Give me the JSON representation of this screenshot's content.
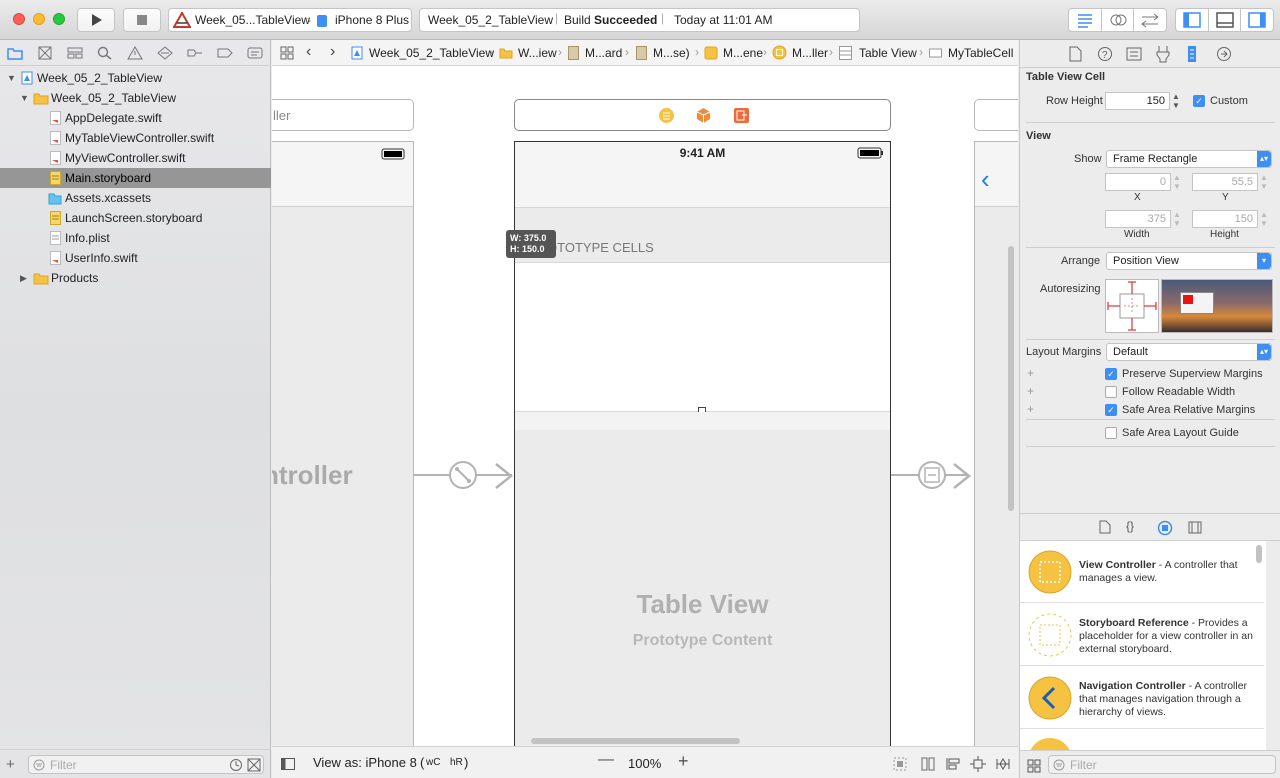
{
  "titlebar": {
    "scheme_target": "Week_05...TableView",
    "scheme_device": "iPhone 8 Plus",
    "activity_project": "Week_05_2_TableView",
    "activity_status_prefix": "Build",
    "activity_status": "Succeeded",
    "activity_time": "Today at 11:01 AM"
  },
  "navigator": {
    "items": [
      {
        "label": "Week_05_2_TableView",
        "kind": "project"
      },
      {
        "label": "Week_05_2_TableView",
        "kind": "folder"
      },
      {
        "label": "AppDelegate.swift",
        "kind": "swift"
      },
      {
        "label": "MyTableViewController.swift",
        "kind": "swift"
      },
      {
        "label": "MyViewController.swift",
        "kind": "swift"
      },
      {
        "label": "Main.storyboard",
        "kind": "storyboard"
      },
      {
        "label": "Assets.xcassets",
        "kind": "assets"
      },
      {
        "label": "LaunchScreen.storyboard",
        "kind": "storyboard"
      },
      {
        "label": "Info.plist",
        "kind": "plist"
      },
      {
        "label": "UserInfo.swift",
        "kind": "swift"
      },
      {
        "label": "Products",
        "kind": "folder"
      }
    ],
    "filter_placeholder": "Filter"
  },
  "jumpbar": {
    "crumbs": [
      "Week_05_2_TableView",
      "W...iew",
      "M...ard",
      "M...se)",
      "M...ene",
      "M...ller",
      "Table View",
      "MyTableCell"
    ]
  },
  "canvas": {
    "left_scene_title": "ller",
    "left_scene_label": "ntroller",
    "status_time": "9:41 AM",
    "prototype_header": "PROTOTYPE CELLS",
    "size_w": "W: 375.0",
    "size_h": "H: 150.0",
    "table_title": "Table View",
    "table_subtitle": "Prototype Content"
  },
  "bottombar": {
    "view_as": "View as: iPhone 8",
    "size_class_w": "wC",
    "size_class_h": "hR",
    "zoom": "100%"
  },
  "inspector": {
    "cell_section": "Table View Cell",
    "row_height_label": "Row Height",
    "row_height_value": "150",
    "custom_label": "Custom",
    "view_section": "View",
    "show_label": "Show",
    "show_value": "Frame Rectangle",
    "x_value": "0",
    "y_value": "55.5",
    "x_label": "X",
    "y_label": "Y",
    "width_value": "375",
    "height_value": "150",
    "width_label": "Width",
    "height_label": "Height",
    "arrange_label": "Arrange",
    "arrange_value": "Position View",
    "autoresizing_label": "Autoresizing",
    "layout_margins_label": "Layout Margins",
    "layout_margins_value": "Default",
    "preserve_label": "Preserve Superview Margins",
    "readable_label": "Follow Readable Width",
    "safe_margins_label": "Safe Area Relative Margins",
    "safe_guide_label": "Safe Area Layout Guide"
  },
  "library": {
    "items": [
      {
        "title": "View Controller",
        "desc": " - A controller that manages a view."
      },
      {
        "title": "Storyboard Reference",
        "desc": " - Provides a placeholder for a view controller in an external storyboard."
      },
      {
        "title": "Navigation Controller",
        "desc": " - A controller that manages navigation through a hierarchy of views."
      }
    ],
    "filter_placeholder": "Filter"
  },
  "colors": {
    "accent": "#3d8ef5",
    "selection": "#969696",
    "folder": "#f5c242"
  }
}
